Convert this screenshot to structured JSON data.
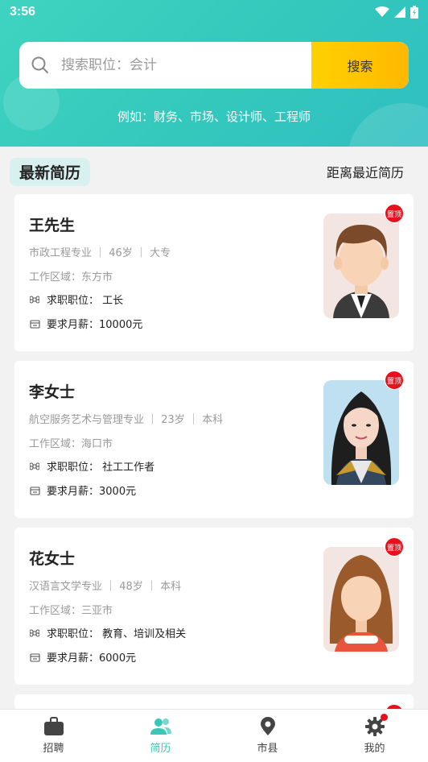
{
  "status": {
    "time": "3:56"
  },
  "search": {
    "placeholder": "搜索职位：会计",
    "button": "搜索",
    "hint": "例如：财务、市场、设计师、工程师"
  },
  "section": {
    "title": "最新简历",
    "link": "距离最近简历"
  },
  "cards": [
    {
      "name": "王先生",
      "meta": "市政工程专业 ｜ 46岁 ｜ 大专",
      "area": "工作区域：东方市",
      "job": "求职职位： 工长",
      "salary": "要求月薪：10000元",
      "pin": "置顶"
    },
    {
      "name": "李女士",
      "meta": "航空服务艺术与管理专业 ｜ 23岁 ｜ 本科",
      "area": "工作区域：海口市",
      "job": "求职职位： 社工工作者",
      "salary": "要求月薪：3000元",
      "pin": "置顶"
    },
    {
      "name": "花女士",
      "meta": "汉语言文学专业 ｜ 48岁 ｜ 本科",
      "area": "工作区域：三亚市",
      "job": "求职职位： 教育、培训及相关",
      "salary": "要求月薪：6000元",
      "pin": "置顶"
    }
  ],
  "nav": {
    "items": [
      "招聘",
      "简历",
      "市县",
      "我的"
    ],
    "active": "简历"
  },
  "colors": {
    "accent": "#3bc7b7",
    "button": "#ffc400",
    "pin": "#e8101c"
  }
}
